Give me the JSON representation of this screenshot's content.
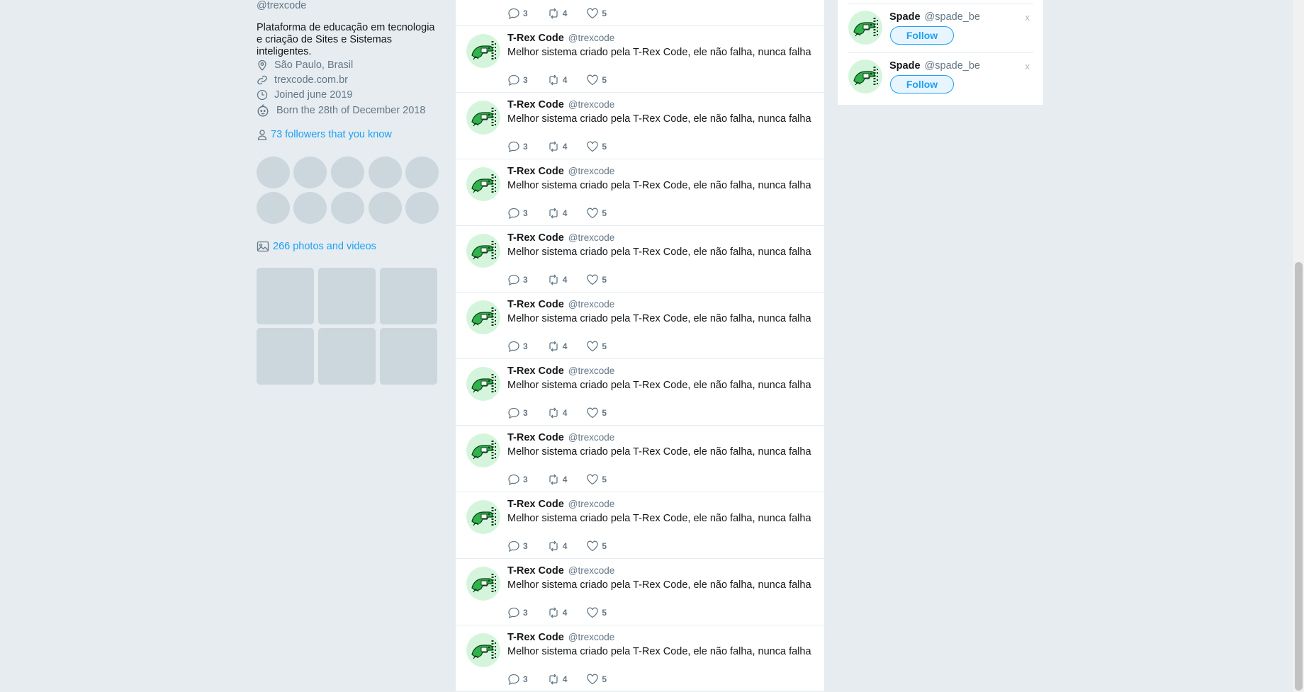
{
  "colors": {
    "accent": "#1da1f2",
    "muted": "#657786",
    "background": "#e6ecf0",
    "placeholder": "#ccd6dd"
  },
  "profile": {
    "handle": "@trexcode",
    "bio": "Plataforma de educação em tecnologia e criação de Sites e Sistemas inteligentes.",
    "location": "São Paulo, Brasil",
    "website": "trexcode.com.br",
    "joined": "Joined june 2019",
    "born": "Born the 28th of December 2018",
    "followers_you_know": "73 followers that you know",
    "photos_videos": "266 photos and videos",
    "icons": [
      "location-icon",
      "link-icon",
      "calendar-icon",
      "birthday-icon",
      "person-icon",
      "image-icon"
    ]
  },
  "timeline": {
    "partial_top_tweet": {
      "replies": "3",
      "retweets": "4",
      "likes": "5"
    },
    "tweets": [
      {
        "name": "T-Rex Code",
        "username": "@trexcode",
        "text": "Melhor sistema criado pela T-Rex Code, ele não falha, nunca falha",
        "replies": "3",
        "retweets": "4",
        "likes": "5"
      },
      {
        "name": "T-Rex Code",
        "username": "@trexcode",
        "text": "Melhor sistema criado pela T-Rex Code, ele não falha, nunca falha",
        "replies": "3",
        "retweets": "4",
        "likes": "5"
      },
      {
        "name": "T-Rex Code",
        "username": "@trexcode",
        "text": "Melhor sistema criado pela T-Rex Code, ele não falha, nunca falha",
        "replies": "3",
        "retweets": "4",
        "likes": "5"
      },
      {
        "name": "T-Rex Code",
        "username": "@trexcode",
        "text": "Melhor sistema criado pela T-Rex Code, ele não falha, nunca falha",
        "replies": "3",
        "retweets": "4",
        "likes": "5"
      },
      {
        "name": "T-Rex Code",
        "username": "@trexcode",
        "text": "Melhor sistema criado pela T-Rex Code, ele não falha, nunca falha",
        "replies": "3",
        "retweets": "4",
        "likes": "5"
      },
      {
        "name": "T-Rex Code",
        "username": "@trexcode",
        "text": "Melhor sistema criado pela T-Rex Code, ele não falha, nunca falha",
        "replies": "3",
        "retweets": "4",
        "likes": "5"
      },
      {
        "name": "T-Rex Code",
        "username": "@trexcode",
        "text": "Melhor sistema criado pela T-Rex Code, ele não falha, nunca falha",
        "replies": "3",
        "retweets": "4",
        "likes": "5"
      },
      {
        "name": "T-Rex Code",
        "username": "@trexcode",
        "text": "Melhor sistema criado pela T-Rex Code, ele não falha, nunca falha",
        "replies": "3",
        "retweets": "4",
        "likes": "5"
      },
      {
        "name": "T-Rex Code",
        "username": "@trexcode",
        "text": "Melhor sistema criado pela T-Rex Code, ele não falha, nunca falha",
        "replies": "3",
        "retweets": "4",
        "likes": "5"
      },
      {
        "name": "T-Rex Code",
        "username": "@trexcode",
        "text": "Melhor sistema criado pela T-Rex Code, ele não falha, nunca falha",
        "replies": "3",
        "retweets": "4",
        "likes": "5"
      }
    ]
  },
  "suggestions": [
    {
      "name": "Spade",
      "username": "@spade_be",
      "follow_label": "Follow",
      "close_label": "x"
    },
    {
      "name": "Spade",
      "username": "@spade_be",
      "follow_label": "Follow",
      "close_label": "x"
    }
  ]
}
